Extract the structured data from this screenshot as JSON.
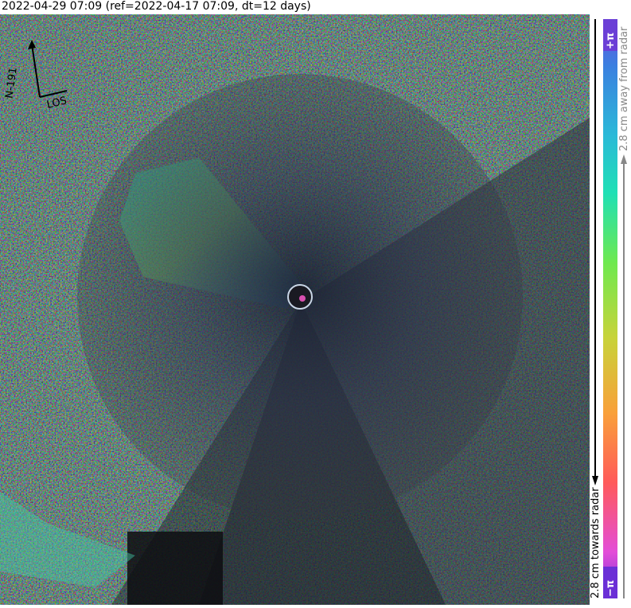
{
  "title": "2022-04-29 07:09 (ref=2022-04-17 07:09, dt=12 days)",
  "compass": {
    "north_label": "N-191",
    "los_label": "LOS"
  },
  "colorbar": {
    "top_symbol": "+π",
    "bottom_symbol": "−π",
    "away_label": "2.8 cm away from radar",
    "towards_label": "2.8 cm towards radar",
    "colors": [
      "#e34dd8",
      "#ff5a5a",
      "#f9a03a",
      "#c8d33a",
      "#6ee94f",
      "#1fe0b5",
      "#2ab9d8",
      "#3b7fe0",
      "#6b4fe0"
    ],
    "badge_color": "#6b2fd6"
  }
}
